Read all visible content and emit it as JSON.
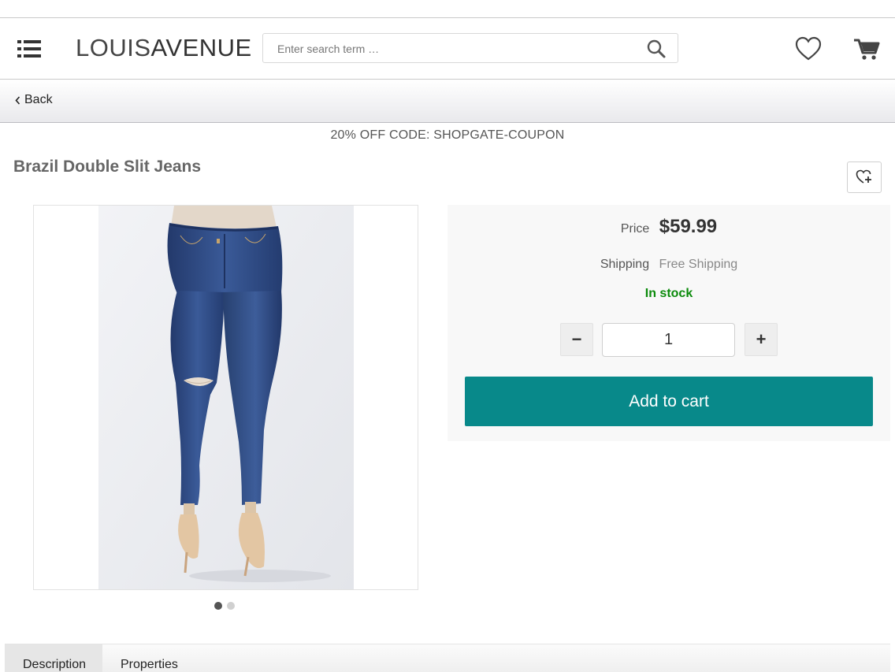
{
  "header": {
    "logo_part1": "LOUIS",
    "logo_part2": "AVENUE",
    "search_placeholder": "Enter search term …",
    "icons": {
      "menu": "menu-icon",
      "search": "search-icon",
      "wishlist": "heart-icon",
      "cart": "cart-icon"
    }
  },
  "nav": {
    "back_label": "Back",
    "back_icon": "chevron-left-icon"
  },
  "promo": {
    "coupon_text": "20% OFF CODE: SHOPGATE-COUPON"
  },
  "product": {
    "title": "Brazil Double Slit Jeans",
    "favorite_icon": "heart-plus-icon",
    "image_dots": [
      {
        "active": true
      },
      {
        "active": false
      }
    ]
  },
  "buybox": {
    "price_label": "Price",
    "price_value": "$59.99",
    "shipping_label": "Shipping",
    "shipping_value": "Free Shipping",
    "stock_status": "In stock",
    "quantity_minus": "−",
    "quantity_value": "1",
    "quantity_plus": "+",
    "add_to_cart_label": "Add to cart"
  },
  "tabs": [
    {
      "label": "Description",
      "active": true
    },
    {
      "label": "Properties",
      "active": false
    }
  ],
  "colors": {
    "accent": "#08898a",
    "in_stock": "#0a8a0a",
    "denim": "#2e4a84",
    "photo_background": "#eceef2"
  }
}
